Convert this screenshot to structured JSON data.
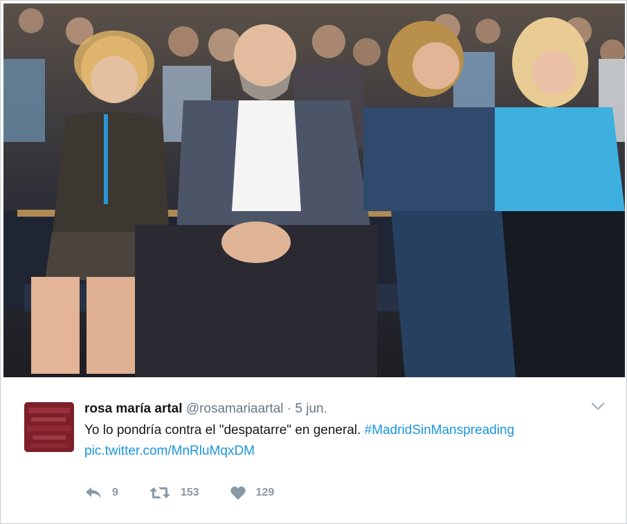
{
  "tweet": {
    "author_name": "rosa maría artal",
    "handle": "@rosamariaartal",
    "separator": "·",
    "date": "5 jun.",
    "text": "Yo lo pondría contra el \"despatarre\" en general.",
    "hashtag": "#MadridSinManspreading",
    "pic_link": "pic.twitter.com/MnRluMqxDM",
    "reply_count": "9",
    "retweet_count": "153",
    "like_count": "129"
  },
  "icons": {
    "more": "chevron-down-icon",
    "reply": "reply-icon",
    "retweet": "retweet-icon",
    "like": "heart-icon"
  },
  "colors": {
    "link": "#1b95e0",
    "text": "#14171a",
    "muted": "#657786",
    "action": "#8899a6"
  }
}
